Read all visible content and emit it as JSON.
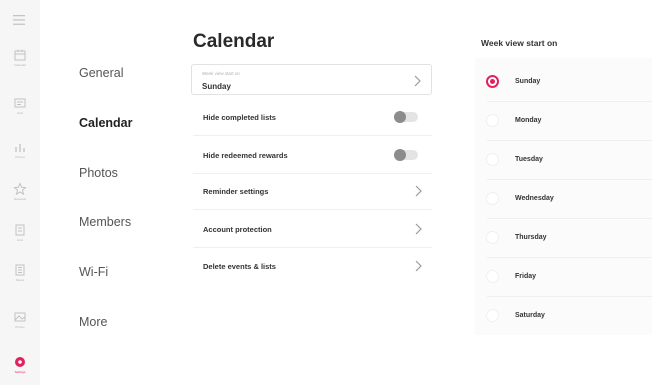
{
  "rail": {
    "items": [
      {
        "icon": "calendar-icon",
        "caption": "Calendar",
        "active": false
      },
      {
        "icon": "board-icon",
        "caption": "Lists",
        "active": false
      },
      {
        "icon": "chart-icon",
        "caption": "Chores",
        "active": false
      },
      {
        "icon": "star-icon",
        "caption": "Rewards",
        "active": false
      },
      {
        "icon": "box-icon",
        "caption": "Lists",
        "active": false
      },
      {
        "icon": "meal-icon",
        "caption": "Meals",
        "active": false
      },
      {
        "icon": "photo-icon",
        "caption": "Photos",
        "active": false
      },
      {
        "icon": "gear-icon",
        "caption": "Settings",
        "active": true
      }
    ]
  },
  "categories": {
    "general": "General",
    "calendar": "Calendar",
    "photos": "Photos",
    "members": "Members",
    "wifi": "Wi-Fi",
    "more": "More"
  },
  "calendar_panel": {
    "title": "Calendar",
    "week_view": {
      "label": "Week view start on",
      "value": "Sunday"
    },
    "rows": {
      "hide_completed": "Hide completed lists",
      "hide_redeemed": "Hide redeemed rewards",
      "reminder_settings": "Reminder settings",
      "account_protection": "Account protection",
      "delete_events": "Delete events & lists"
    },
    "toggles": {
      "hide_completed": false,
      "hide_redeemed": false
    }
  },
  "week_panel": {
    "title": "Week view start on",
    "options": [
      "Sunday",
      "Monday",
      "Tuesday",
      "Wednesday",
      "Thursday",
      "Friday",
      "Saturday"
    ],
    "selected": "Sunday"
  },
  "colors": {
    "accent": "#e2215e",
    "toggle_off": "#8c8c8c"
  }
}
